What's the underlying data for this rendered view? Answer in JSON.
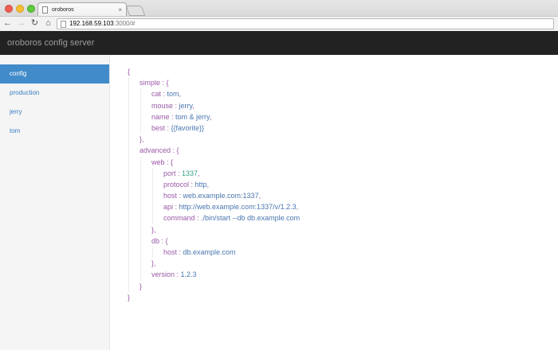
{
  "browser": {
    "tab_title": "oroboros",
    "tab_close": "×",
    "url_host": "192.168.59.103",
    "url_rest": ":3000/#"
  },
  "app": {
    "title": "oroboros config server"
  },
  "sidebar": {
    "items": [
      {
        "label": "config",
        "active": true
      },
      {
        "label": "production",
        "active": false
      },
      {
        "label": "jerry",
        "active": false
      },
      {
        "label": "tom",
        "active": false
      }
    ]
  },
  "config_json": {
    "simple": {
      "cat": "tom",
      "mouse": "jerry",
      "name": "tom & jerry",
      "best": "{{favorite}}"
    },
    "advanced": {
      "web": {
        "port": "1337",
        "protocol": "http",
        "host": "web.example.com:1337",
        "api": "http://web.example.com:1337/v/1.2.3",
        "command": "./bin/start --db db.example.com"
      },
      "db": {
        "host": "db.example.com"
      },
      "version": "1.2.3"
    }
  },
  "colors": {
    "key": "#9b59a7",
    "string": "#4a77b0",
    "number": "#3aa189",
    "active_nav": "#428bca",
    "appbar": "#222222"
  }
}
